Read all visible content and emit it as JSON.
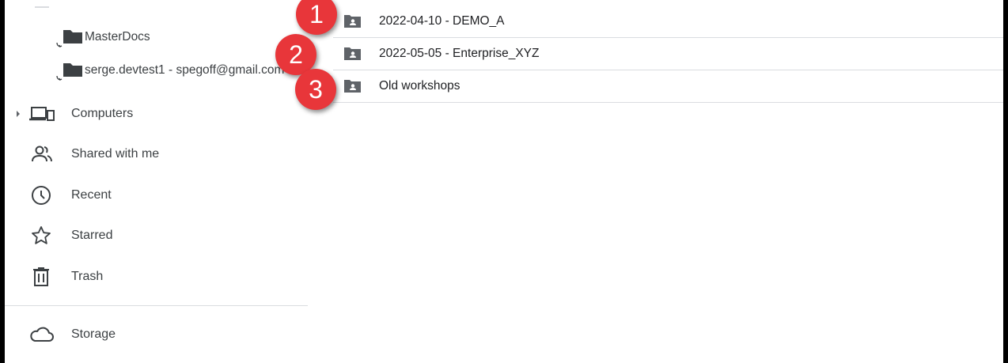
{
  "sidebar": {
    "shared_drives": [
      {
        "label": "MasterDocs",
        "icon": "shared-drive-icon"
      },
      {
        "label": "serge.devtest1 - spegoff@gmail.com",
        "icon": "shared-drive-icon"
      }
    ],
    "items": [
      {
        "label": "Computers",
        "icon": "computer-icon"
      },
      {
        "label": "Shared with me",
        "icon": "people-icon"
      },
      {
        "label": "Recent",
        "icon": "clock-icon"
      },
      {
        "label": "Starred",
        "icon": "star-icon"
      },
      {
        "label": "Trash",
        "icon": "trash-icon"
      }
    ],
    "storage": {
      "label": "Storage",
      "icon": "cloud-icon"
    }
  },
  "files": [
    {
      "name": "2022-04-10 - DEMO_A",
      "icon": "shared-folder-icon"
    },
    {
      "name": "2022-05-05 - Enterprise_XYZ",
      "icon": "shared-folder-icon"
    },
    {
      "name": "Old workshops",
      "icon": "shared-folder-icon"
    }
  ],
  "badges": [
    "1",
    "2",
    "3"
  ],
  "colors": {
    "badge": "#e8363a",
    "icon": "#5f6368",
    "text": "#3c4043",
    "divider": "#dadce0"
  }
}
